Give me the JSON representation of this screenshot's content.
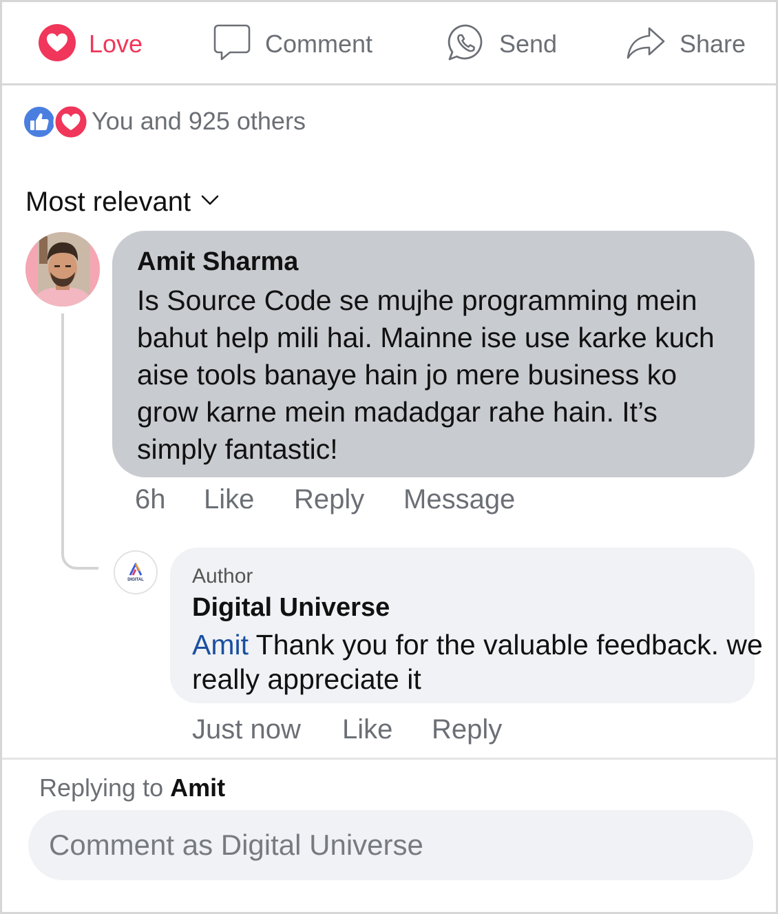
{
  "action_bar": {
    "love_label": "Love",
    "comment_label": "Comment",
    "send_label": "Send",
    "share_label": "Share",
    "love_color": "#f0365a",
    "muted_color": "#6b6f75"
  },
  "reactions": {
    "summary": "You and 925 others",
    "like_color": "#4a7fe0",
    "heart_color": "#f0365a"
  },
  "sort": {
    "label": "Most relevant"
  },
  "comment": {
    "author": "Amit Sharma",
    "text": "Is Source Code se mujhe programming mein bahut help mili hai. Mainne ise use karke kuch aise tools banaye hain jo mere business ko grow karne mein madadgar rahe hain. It’s simply fantastic!",
    "time": "6h",
    "like_label": "Like",
    "reply_label": "Reply",
    "message_label": "Message",
    "bubble_color": "#c8cbd0"
  },
  "reply": {
    "tag": "Author",
    "author": "Digital Universe",
    "mention": "Amit",
    "text": " Thank you for the valuable feedback. we really appreciate it",
    "time": "Just now",
    "like_label": "Like",
    "reply_label": "Reply",
    "avatar_text": "DIGITAL",
    "mention_color": "#1b4fa0"
  },
  "composer": {
    "replying_prefix": "Replying to ",
    "replying_name": "Amit",
    "placeholder": "Comment as Digital Universe"
  }
}
